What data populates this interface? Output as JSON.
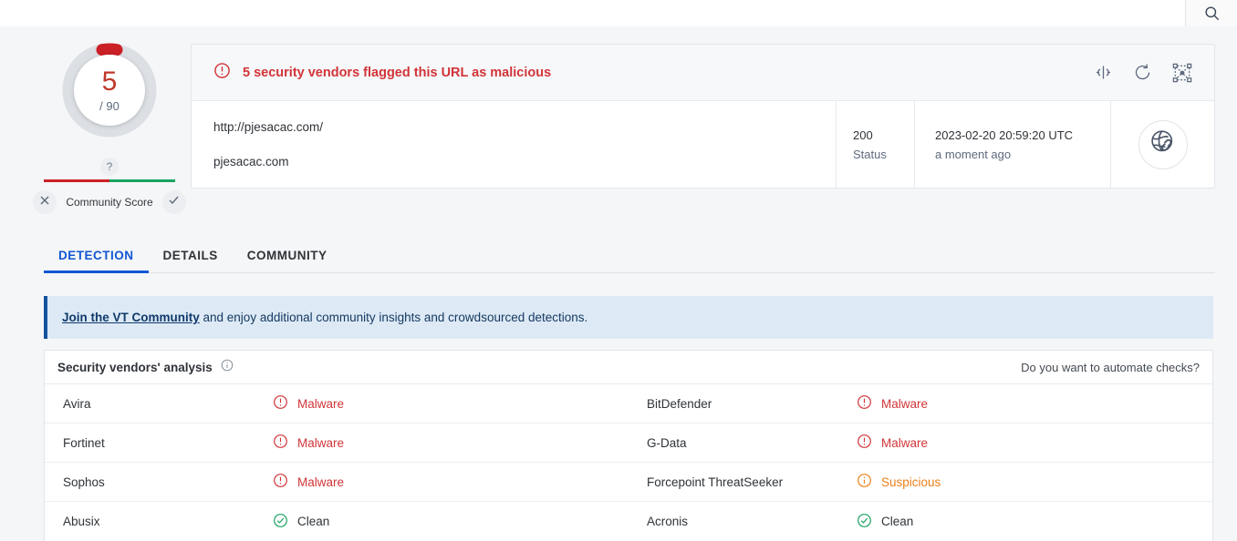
{
  "topbar": {
    "search_icon": "search-icon"
  },
  "score": {
    "value": "5",
    "total": "/ 90",
    "question_mark": "?",
    "community_label": "Community Score",
    "vote_down_icon": "close-icon",
    "vote_up_icon": "check-icon"
  },
  "alert": {
    "icon": "alert-circle-icon",
    "text": "5 security vendors flagged this URL as malicious",
    "actions": [
      {
        "name": "similar-icon",
        "title": "similar"
      },
      {
        "name": "reanalyze-icon",
        "title": "reanalyze"
      },
      {
        "name": "graph-icon",
        "title": "graph"
      }
    ]
  },
  "url_info": {
    "url": "http://pjesacac.com/",
    "domain": "pjesacac.com",
    "status_value": "200",
    "status_label": "Status",
    "scan_date": "2023-02-20 20:59:20 UTC",
    "scan_relative": "a moment ago",
    "avatar_icon": "globe-link-icon"
  },
  "tabs": [
    {
      "label": "DETECTION",
      "active": true
    },
    {
      "label": "DETAILS",
      "active": false
    },
    {
      "label": "COMMUNITY",
      "active": false
    }
  ],
  "banner": {
    "link": "Join the VT Community",
    "rest": " and enjoy additional community insights and crowdsourced detections."
  },
  "vendors_section": {
    "title": "Security vendors' analysis",
    "info_icon": "info-icon",
    "automate_text": "Do you want to automate checks?"
  },
  "vendors": [
    {
      "name": "Avira",
      "status": "Malware",
      "kind": "malware",
      "name2": "BitDefender",
      "status2": "Malware",
      "kind2": "malware"
    },
    {
      "name": "Fortinet",
      "status": "Malware",
      "kind": "malware",
      "name2": "G-Data",
      "status2": "Malware",
      "kind2": "malware"
    },
    {
      "name": "Sophos",
      "status": "Malware",
      "kind": "malware",
      "name2": "Forcepoint ThreatSeeker",
      "status2": "Suspicious",
      "kind2": "suspicious"
    },
    {
      "name": "Abusix",
      "status": "Clean",
      "kind": "clean",
      "name2": "Acronis",
      "status2": "Clean",
      "kind2": "clean"
    }
  ],
  "colors": {
    "malware": "#d13438",
    "suspicious": "#ef7f1a",
    "clean": "#1aa260",
    "accent": "#1257d4",
    "score_red": "#c0392b"
  }
}
